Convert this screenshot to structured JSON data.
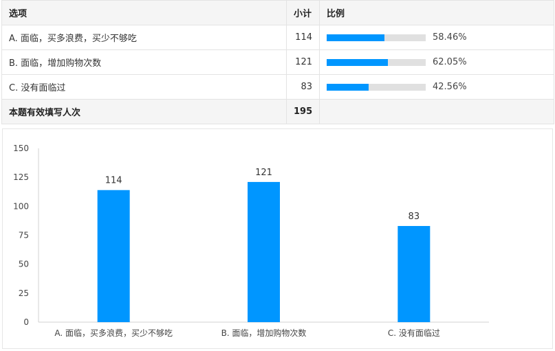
{
  "table": {
    "headers": {
      "option": "选项",
      "count": "小计",
      "ratio": "比例"
    },
    "rows": [
      {
        "option": "A. 面临，买多浪费，买少不够吃",
        "count": "114",
        "percent_label": "58.46%",
        "percent": 58.46
      },
      {
        "option": "B. 面临，增加购物次数",
        "count": "121",
        "percent_label": "62.05%",
        "percent": 62.05
      },
      {
        "option": "C. 没有面临过",
        "count": "83",
        "percent_label": "42.56%",
        "percent": 42.56
      }
    ],
    "total": {
      "label": "本题有效填写人次",
      "count": "195"
    }
  },
  "colors": {
    "bar": "#0096ff",
    "track": "#e0e0e0"
  },
  "chart_data": {
    "type": "bar",
    "categories": [
      "A. 面临，买多浪费，买少不够吃",
      "B. 面临，增加购物次数",
      "C. 没有面临过"
    ],
    "values": [
      114,
      121,
      83
    ],
    "ylim": [
      0,
      150
    ],
    "yticks": [
      0,
      25,
      50,
      75,
      100,
      125,
      150
    ],
    "grid": false,
    "data_labels": true
  }
}
